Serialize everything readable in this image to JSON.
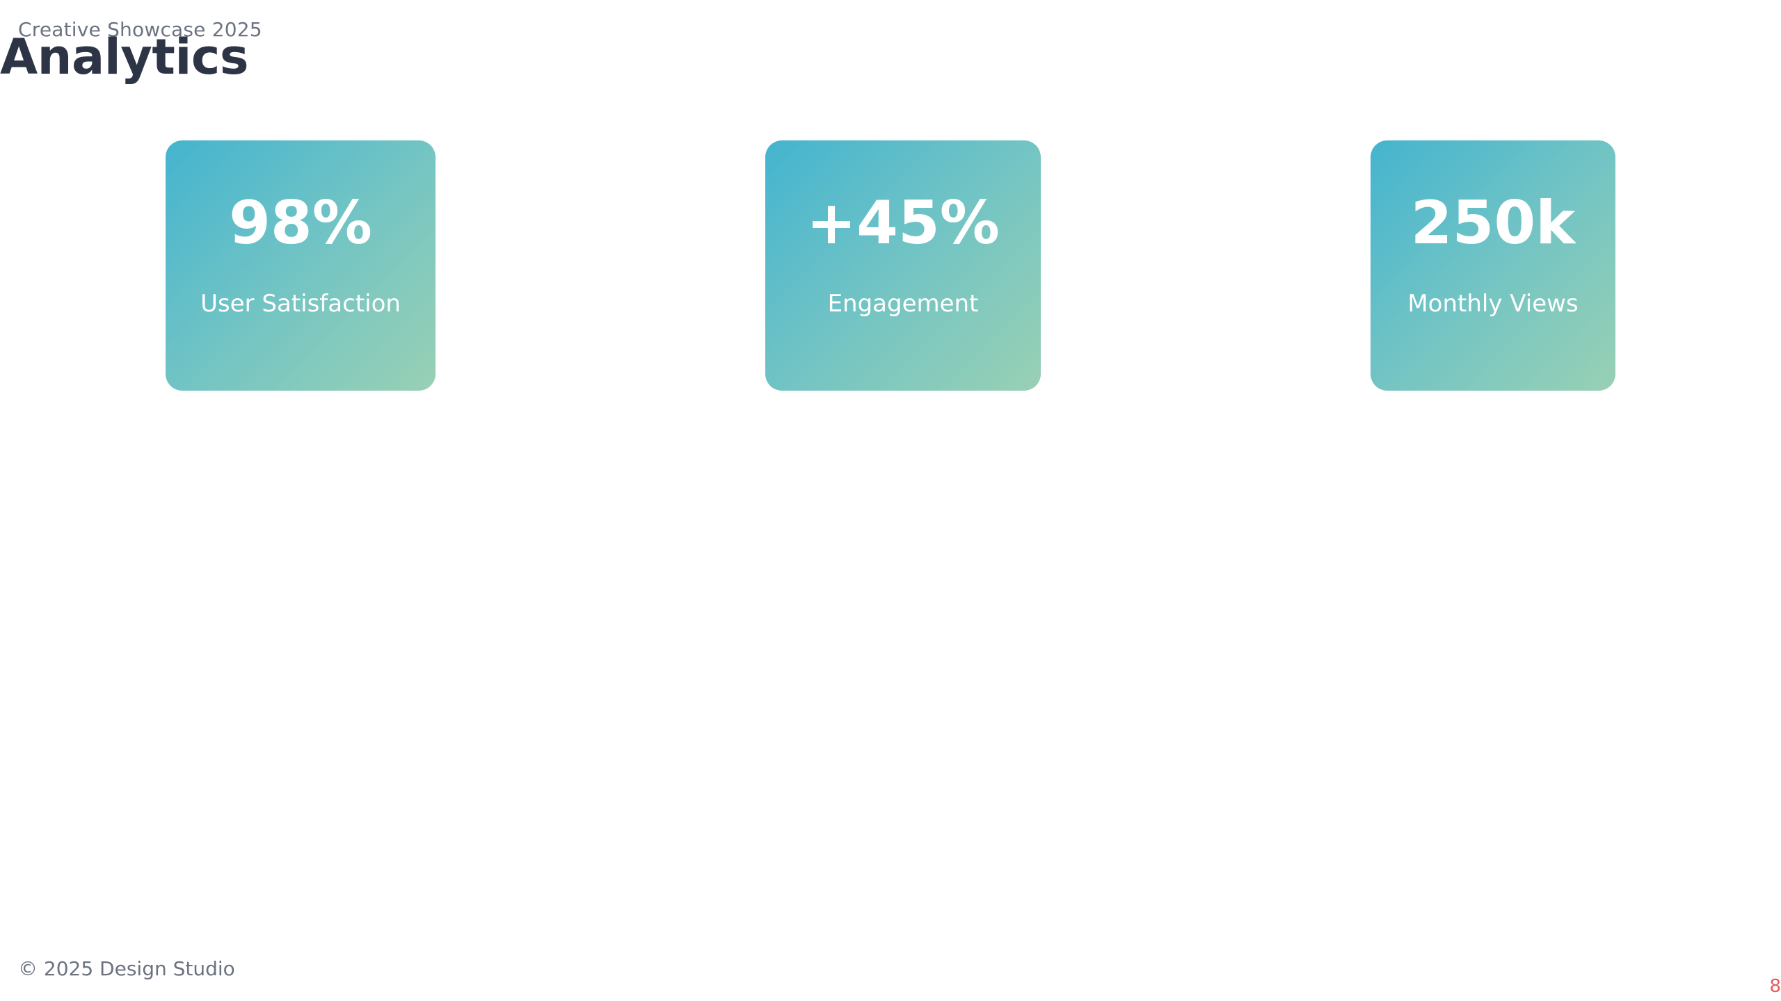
{
  "header": {
    "kicker": "Creative Showcase 2025",
    "title": "Analytics"
  },
  "stats": [
    {
      "value": "98%",
      "label": "User Satisfaction"
    },
    {
      "value": "+45%",
      "label": "Engagement"
    },
    {
      "value": "250k",
      "label": "Monthly Views"
    }
  ],
  "footer": {
    "copyright": "© 2025 Design Studio",
    "page_number": "8"
  },
  "colors": {
    "title": "#2c3446",
    "muted_text": "#6b7280",
    "card_gradient_start": "#44b4cf",
    "card_gradient_end": "#99d0b4",
    "page_number": "#e8585b"
  }
}
